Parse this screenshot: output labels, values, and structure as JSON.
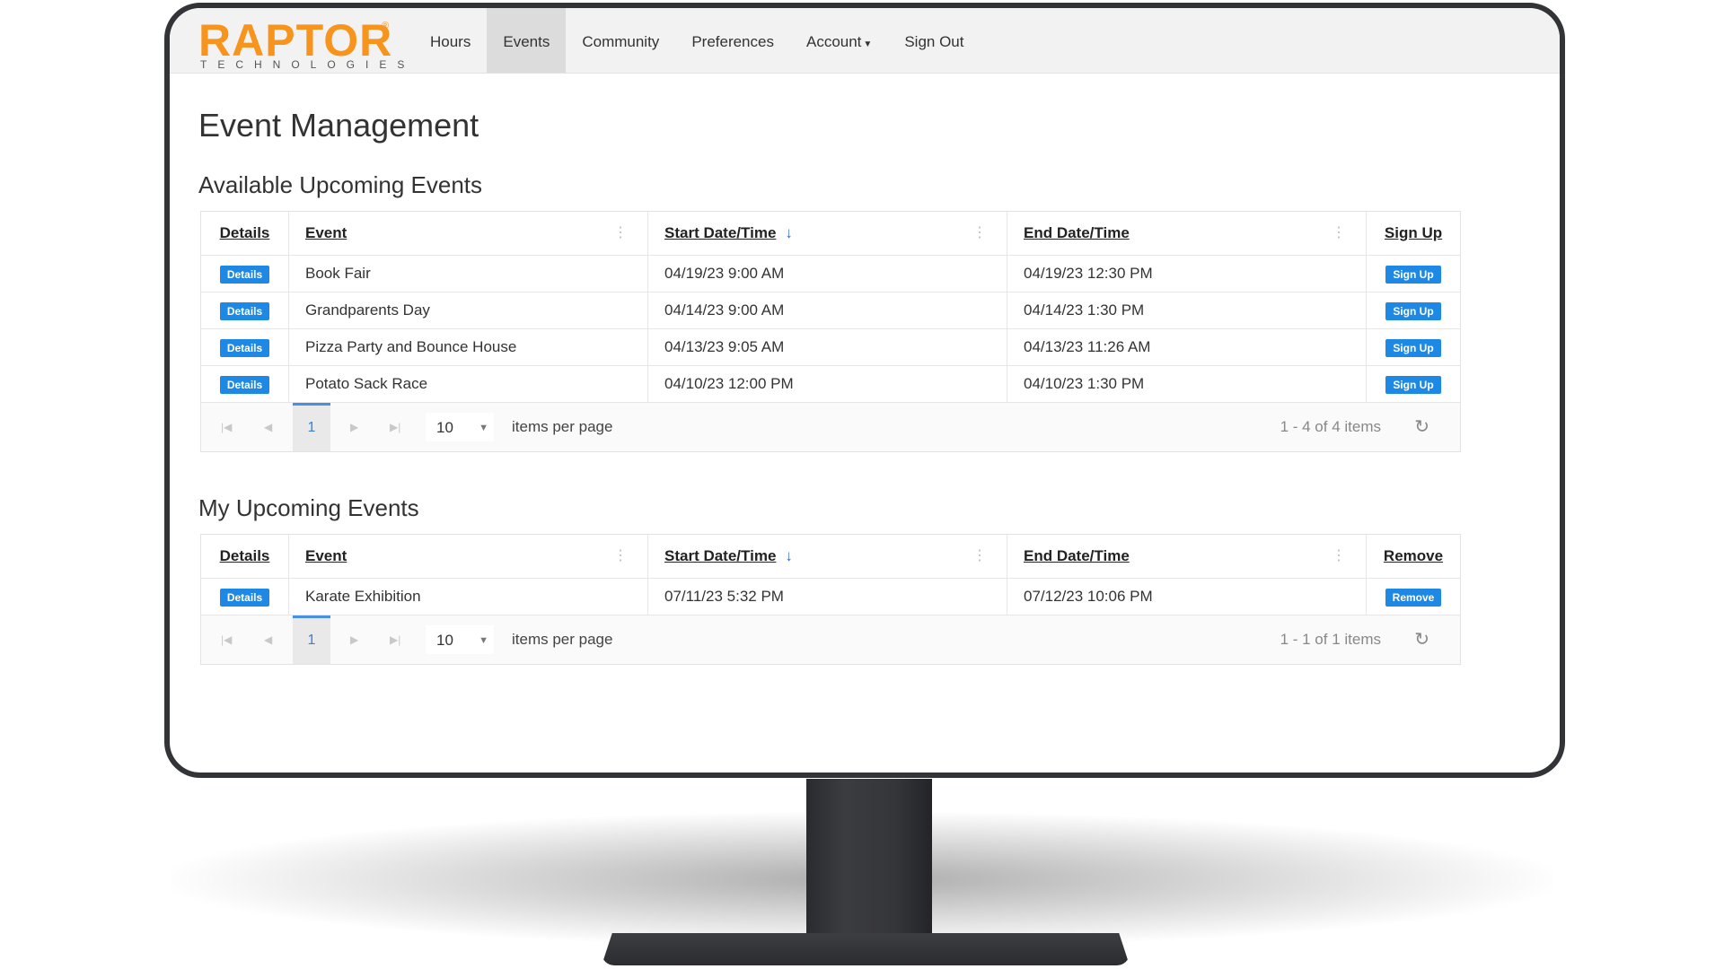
{
  "brand": {
    "name": "RAPTOR",
    "tagline": "TECHNOLOGIES",
    "reg": "®",
    "color": "#f7941d"
  },
  "nav": {
    "items": [
      {
        "label": "Hours"
      },
      {
        "label": "Events"
      },
      {
        "label": "Community"
      },
      {
        "label": "Preferences"
      },
      {
        "label": "Account"
      },
      {
        "label": "Sign Out"
      }
    ],
    "active": "Events"
  },
  "page": {
    "title": "Event Management"
  },
  "available": {
    "title": "Available Upcoming Events",
    "columns": [
      "Details",
      "Event",
      "Start Date/Time",
      "End Date/Time",
      "Sign Up"
    ],
    "rows": [
      {
        "details_btn": "Details",
        "event": "Book Fair",
        "start": "04/19/23 9:00 AM",
        "end": "04/19/23 12:30 PM",
        "action": "Sign Up"
      },
      {
        "details_btn": "Details",
        "event": "Grandparents Day",
        "start": "04/14/23 9:00 AM",
        "end": "04/14/23 1:30 PM",
        "action": "Sign Up"
      },
      {
        "details_btn": "Details",
        "event": "Pizza Party and Bounce House",
        "start": "04/13/23 9:05 AM",
        "end": "04/13/23 11:26 AM",
        "action": "Sign Up"
      },
      {
        "details_btn": "Details",
        "event": "Potato Sack Race",
        "start": "04/10/23 12:00 PM",
        "end": "04/10/23 1:30 PM",
        "action": "Sign Up"
      }
    ],
    "pager": {
      "page": "1",
      "page_size": "10",
      "per_page_label": "items per page",
      "count": "1 - 4 of 4 items"
    }
  },
  "mine": {
    "title": "My Upcoming Events",
    "columns": [
      "Details",
      "Event",
      "Start Date/Time",
      "End Date/Time",
      "Remove"
    ],
    "rows": [
      {
        "details_btn": "Details",
        "event": "Karate Exhibition",
        "start": "07/11/23 5:32 PM",
        "end": "07/12/23 10:06 PM",
        "action": "Remove"
      }
    ],
    "pager": {
      "page": "1",
      "page_size": "10",
      "per_page_label": "items per page",
      "count": "1 - 1 of 1 items"
    }
  },
  "icons": {
    "sort": "sort-descending-arrow-icon",
    "column_menu": "vertical-ellipsis-icon",
    "pager": [
      "first-page-icon",
      "previous-page-icon",
      "next-page-icon",
      "last-page-icon"
    ],
    "refresh": "refresh-icon",
    "dropdown": "chevron-down-icon"
  },
  "colors": {
    "button": "#1e88e5",
    "nav_active": "#dcdcdc",
    "page_active": "#3b7fd8"
  }
}
